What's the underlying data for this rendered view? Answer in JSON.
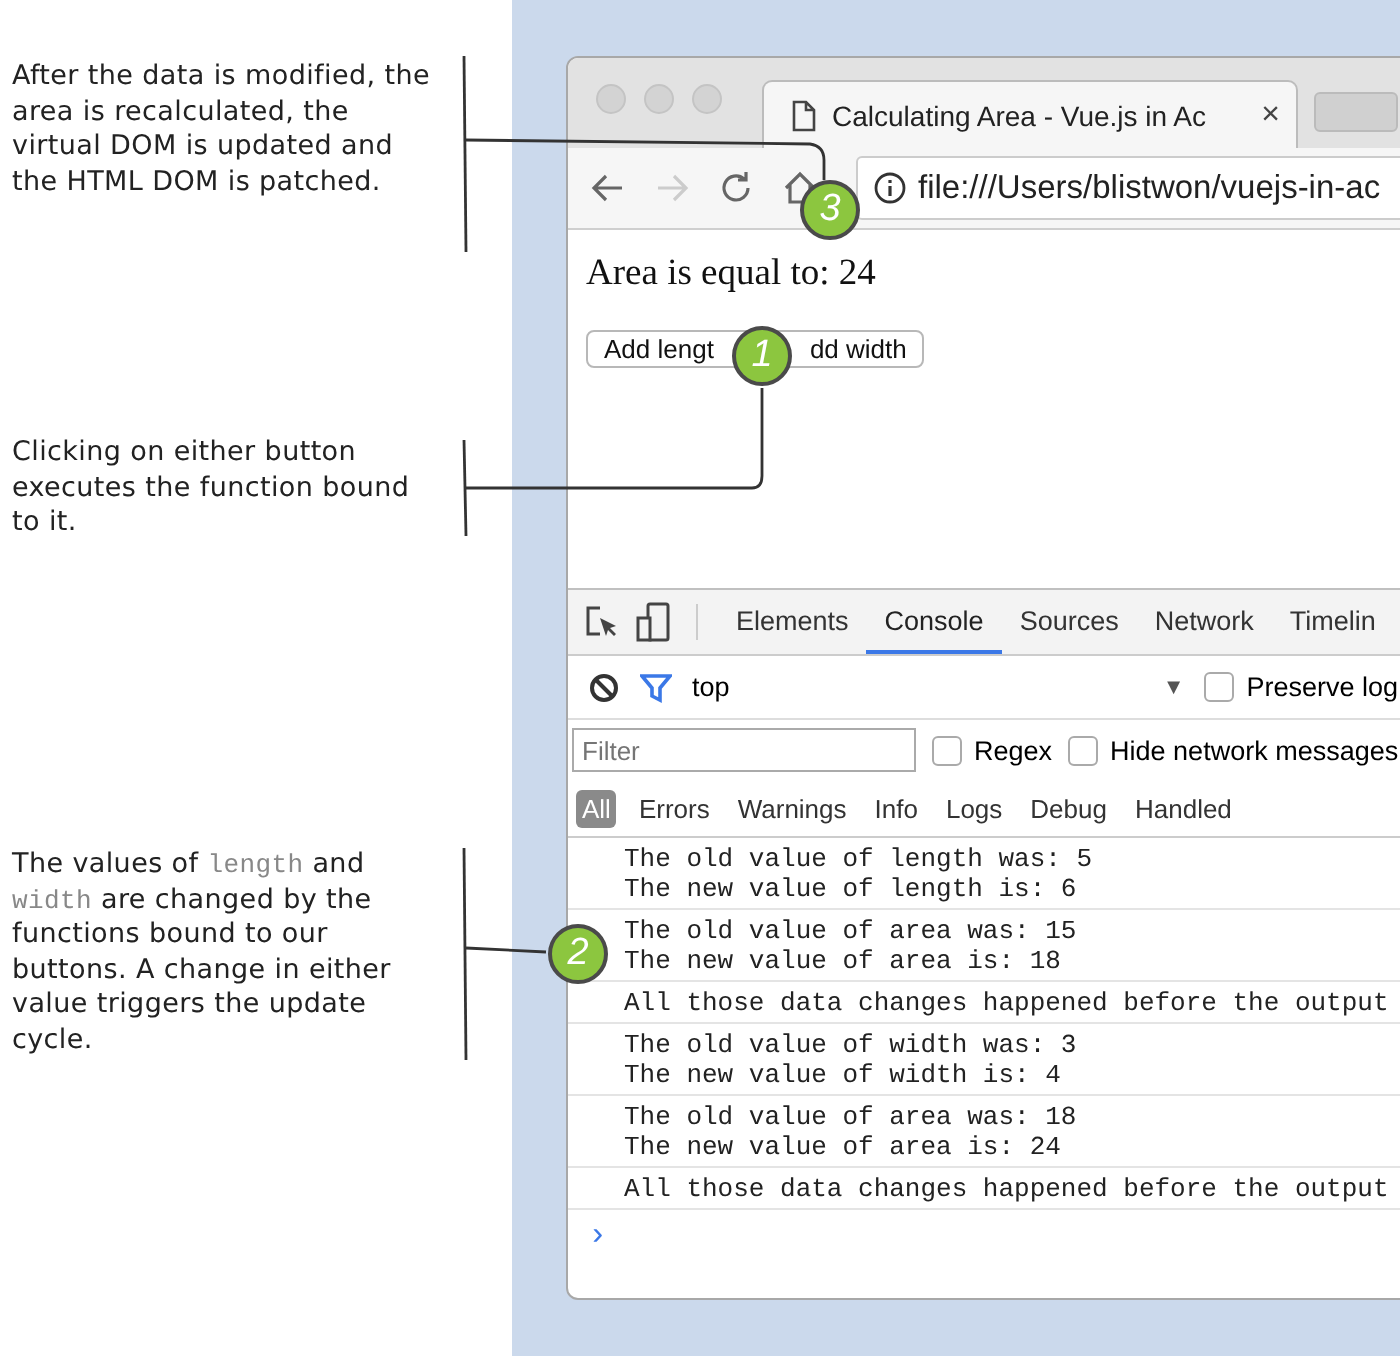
{
  "annotations": [
    {
      "callout": "3",
      "parts": [
        {
          "kind": "text",
          "text": "After the data is modified, the area is recalculated, the virtual DOM is updated and the HTML DOM is patched."
        }
      ]
    },
    {
      "callout": "1",
      "parts": [
        {
          "kind": "text",
          "text": "Clicking on either button executes the function bound to it."
        }
      ]
    },
    {
      "callout": "2",
      "parts": [
        {
          "kind": "text",
          "text": "The values of "
        },
        {
          "kind": "code",
          "text": "length"
        },
        {
          "kind": "text",
          "text": " and "
        },
        {
          "kind": "code",
          "text": "width"
        },
        {
          "kind": "text",
          "text": " are changed by the functions bound to our buttons. A change in either value triggers the update cycle."
        }
      ]
    }
  ],
  "browser": {
    "tab_title": "Calculating Area - Vue.js in Ac",
    "tab_close": "×",
    "address": "file:///Users/blistwon/vuejs-in-ac",
    "page": {
      "heading": "Area is equal to: 24",
      "buttons": [
        "Add lengt",
        "dd width"
      ]
    },
    "devtools": {
      "tabs": [
        {
          "label": "Elements",
          "selected": false
        },
        {
          "label": "Console",
          "selected": true
        },
        {
          "label": "Sources",
          "selected": false
        },
        {
          "label": "Network",
          "selected": false
        },
        {
          "label": "Timelin",
          "selected": false
        }
      ],
      "context": "top",
      "context_caret": "▼",
      "preserve_log": {
        "label": "Preserve log",
        "checked": false
      },
      "filter": {
        "placeholder": "Filter"
      },
      "regex": {
        "label": "Regex",
        "checked": false
      },
      "hide_network": {
        "label": "Hide network messages",
        "checked": false
      },
      "levels": [
        {
          "label": "All",
          "selected": true
        },
        {
          "label": "Errors",
          "selected": false
        },
        {
          "label": "Warnings",
          "selected": false
        },
        {
          "label": "Info",
          "selected": false
        },
        {
          "label": "Logs",
          "selected": false
        },
        {
          "label": "Debug",
          "selected": false
        },
        {
          "label": "Handled",
          "selected": false
        }
      ],
      "messages": [
        {
          "lines": [
            "The old value of length was: 5",
            "The new value of length is: 6"
          ]
        },
        {
          "lines": [
            "The old value of area was: 15",
            "The new value of area is: 18"
          ]
        },
        {
          "lines": [
            "All those data changes happened before the output"
          ]
        },
        {
          "lines": [
            "The old value of width was: 3",
            "The new value of width is: 4"
          ]
        },
        {
          "lines": [
            "The old value of area was: 18",
            "The new value of area is: 24"
          ]
        },
        {
          "lines": [
            "All those data changes happened before the output"
          ]
        }
      ],
      "prompt": "›"
    }
  }
}
